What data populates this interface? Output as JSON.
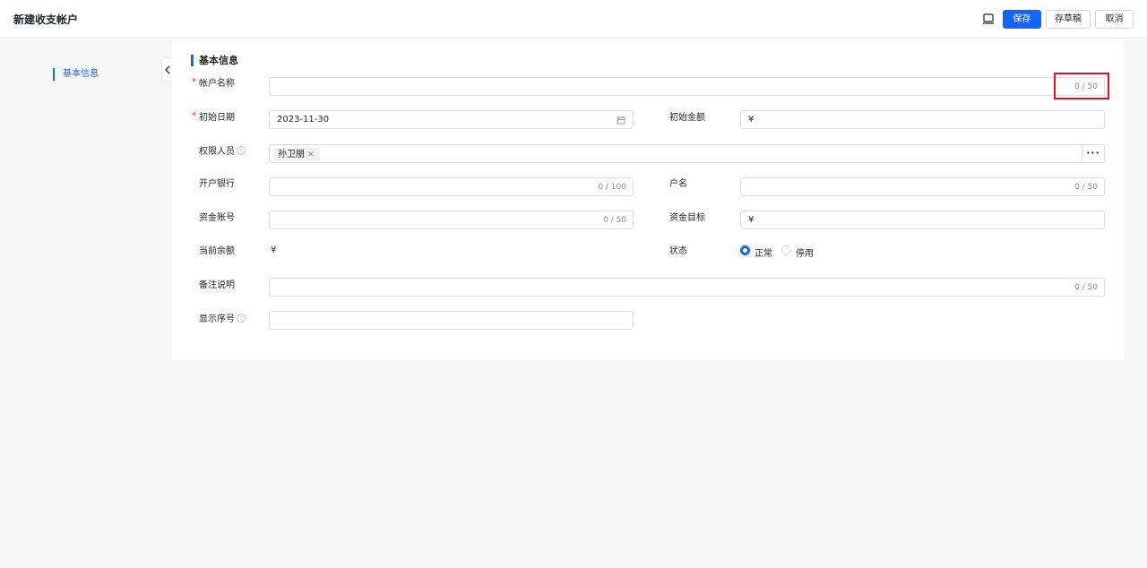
{
  "header": {
    "title": "新建收支帐户",
    "save_label": "保存",
    "draft_label": "存草稿",
    "cancel_label": "取消"
  },
  "nav": {
    "items": [
      {
        "label": "基本信息",
        "active": true
      }
    ]
  },
  "section": {
    "title": "基本信息"
  },
  "form": {
    "account_name": {
      "label": "帐户名称",
      "required": true,
      "value": "",
      "counter": "0 / 50"
    },
    "start_date": {
      "label": "初始日期",
      "required": true,
      "value": "2023-11-30"
    },
    "start_amount": {
      "label": "初始金额",
      "prefix": "¥",
      "value": ""
    },
    "permission_users": {
      "label": "权限人员",
      "tags": [
        "孙卫朋"
      ],
      "more": "···"
    },
    "bank": {
      "label": "开户银行",
      "value": "",
      "counter": "0 / 100"
    },
    "account_holder": {
      "label": "户名",
      "value": "",
      "counter": "0 / 50"
    },
    "fund_account": {
      "label": "资金账号",
      "value": "",
      "counter": "0 / 50"
    },
    "fund_target": {
      "label": "资金目标",
      "prefix": "¥",
      "value": ""
    },
    "current_balance": {
      "label": "当前余额",
      "value": "¥"
    },
    "status": {
      "label": "状态",
      "options": [
        "正常",
        "停用"
      ],
      "selected": "正常"
    },
    "remarks": {
      "label": "备注说明",
      "value": "",
      "counter": "0 / 50"
    },
    "display_order": {
      "label": "显示序号",
      "value": ""
    }
  },
  "colors": {
    "accent": "#1664ff",
    "highlight": "#e8101f",
    "required": "#f5222d"
  }
}
